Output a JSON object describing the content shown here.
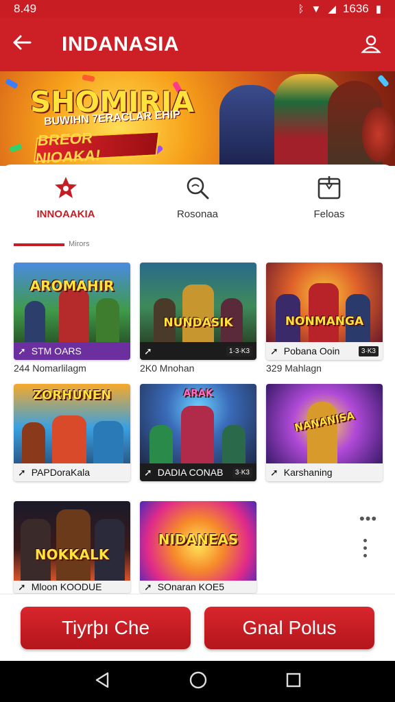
{
  "status": {
    "time": "8.49",
    "right_text": "1636"
  },
  "appbar": {
    "title": "INDANASIA"
  },
  "banner": {
    "title": "SHOMIRIA",
    "subtitle": "BUWIHN 7ERACLAR EHIP",
    "tag": "BREOR NIOAKA!"
  },
  "tabs": [
    {
      "label": "INNOAAKIA",
      "icon": "star-icon",
      "active": true
    },
    {
      "label": "Rosonaa",
      "icon": "search-icon",
      "active": false
    },
    {
      "label": "Feloas",
      "icon": "calendar-icon",
      "active": false
    }
  ],
  "subhint": "Mirors",
  "games": [
    {
      "art_title": "AROMAHIR",
      "bar_label": "STM OARS",
      "badge": "",
      "caption": "244 Nomarlilagm",
      "bar_bg": "#6b2fa0",
      "bar_fg": "#ffffff"
    },
    {
      "art_title": "NUNDASIK",
      "bar_label": "",
      "badge": "1·3·K3",
      "caption": "2K0 Mnohan",
      "bar_bg": "#1c1c1c",
      "bar_fg": "#ffffff"
    },
    {
      "art_title": "NONMANGA",
      "bar_label": "Pobana Ooin",
      "badge": "3·K3",
      "caption": "329 Mahlagn",
      "bar_bg": "#f2f2f2",
      "bar_fg": "#111111"
    },
    {
      "art_title": "ZORHUNEN",
      "bar_label": "PAPDoraKala",
      "badge": "",
      "caption": "",
      "bar_bg": "#f2f2f2",
      "bar_fg": "#111111"
    },
    {
      "art_title": "ARAK",
      "bar_label": "DADIA CONAB",
      "badge": "3·K3",
      "caption": "",
      "bar_bg": "#1c1c1c",
      "bar_fg": "#ffffff"
    },
    {
      "art_title": "NANANISA",
      "bar_label": "Karshaning",
      "badge": "",
      "caption": "",
      "bar_bg": "#f2f2f2",
      "bar_fg": "#111111"
    },
    {
      "art_title": "NOKKALK",
      "bar_label": "Mloon KOODUE",
      "badge": "",
      "caption": "",
      "bar_bg": "#f2f2f2",
      "bar_fg": "#111111"
    },
    {
      "art_title": "NIDANEAS",
      "bar_label": "SOnaran KOE5",
      "badge": "",
      "caption": "",
      "bar_bg": "#f2f2f2",
      "bar_fg": "#111111"
    }
  ],
  "actions": {
    "primary": "Tiyrþı Che",
    "secondary": "Gnal Polus"
  },
  "colors": {
    "brand_red": "#cc1f26",
    "active_red": "#c41e24"
  }
}
